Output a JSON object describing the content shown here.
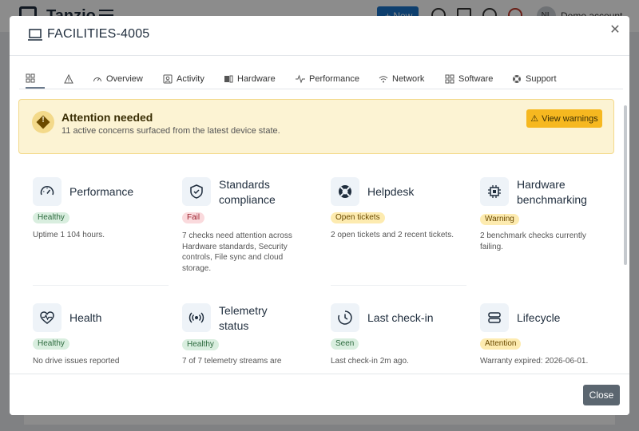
{
  "background": {
    "brand": "Tanzio",
    "new_button": "+ New",
    "avatar_initials": "NL",
    "account_label": "Demo account"
  },
  "modal": {
    "title": "FACILITIES-4005",
    "close_icon": "close-icon",
    "tabs": [
      {
        "label": "",
        "icon": "grid-icon"
      },
      {
        "label": "",
        "icon": "warning-icon"
      },
      {
        "label": "Overview",
        "icon": "gauge-icon"
      },
      {
        "label": "Activity",
        "icon": "activity-icon"
      },
      {
        "label": "Hardware",
        "icon": "hardware-icon"
      },
      {
        "label": "Performance",
        "icon": "pulse-icon"
      },
      {
        "label": "Network",
        "icon": "wifi-icon"
      },
      {
        "label": "Software",
        "icon": "apps-icon"
      },
      {
        "label": "Support",
        "icon": "lifebuoy-icon"
      }
    ],
    "alert": {
      "title": "Attention needed",
      "subtitle": "11 active concerns surfaced from the latest device state.",
      "button": "View warnings",
      "color": "#fcf3d3"
    },
    "cards": [
      {
        "title_lines": [
          "Performance"
        ],
        "badge": "Healthy",
        "status": "green",
        "desc": "Uptime 1 104 hours.",
        "icon": "gauge-icon"
      },
      {
        "title_lines": [
          "Standards",
          "compliance"
        ],
        "badge": "Fail",
        "status": "red",
        "desc": "7 checks need attention across Hardware standards, Security controls, File sync and cloud storage.",
        "icon": "shield-check-icon"
      },
      {
        "title_lines": [
          "Helpdesk"
        ],
        "badge": "Open tickets",
        "status": "yellow",
        "desc": "2 open tickets and 2 recent tickets.",
        "icon": "lifebuoy-icon"
      },
      {
        "title_lines": [
          "Hardware",
          "benchmarking"
        ],
        "badge": "Warning",
        "status": "yellow",
        "desc": "2 benchmark checks currently failing.",
        "icon": "chip-icon"
      },
      {
        "title_lines": [
          "Health"
        ],
        "badge": "Healthy",
        "status": "green",
        "desc": "No drive issues reported",
        "icon": "heart-pulse-icon"
      },
      {
        "title_lines": [
          "Telemetry",
          "status"
        ],
        "badge": "Healthy",
        "status": "green",
        "desc": "7 of 7 telemetry streams are",
        "icon": "broadcast-icon"
      },
      {
        "title_lines": [
          "Last check-in"
        ],
        "badge": "Seen",
        "status": "green",
        "desc": "Last check-in 2m ago.",
        "icon": "clock-icon"
      },
      {
        "title_lines": [
          "Lifecycle"
        ],
        "badge": "Attention",
        "status": "yellow",
        "desc": "Warranty expired: 2026-06-01.",
        "icon": "server-icon"
      }
    ],
    "close_button": "Close"
  }
}
